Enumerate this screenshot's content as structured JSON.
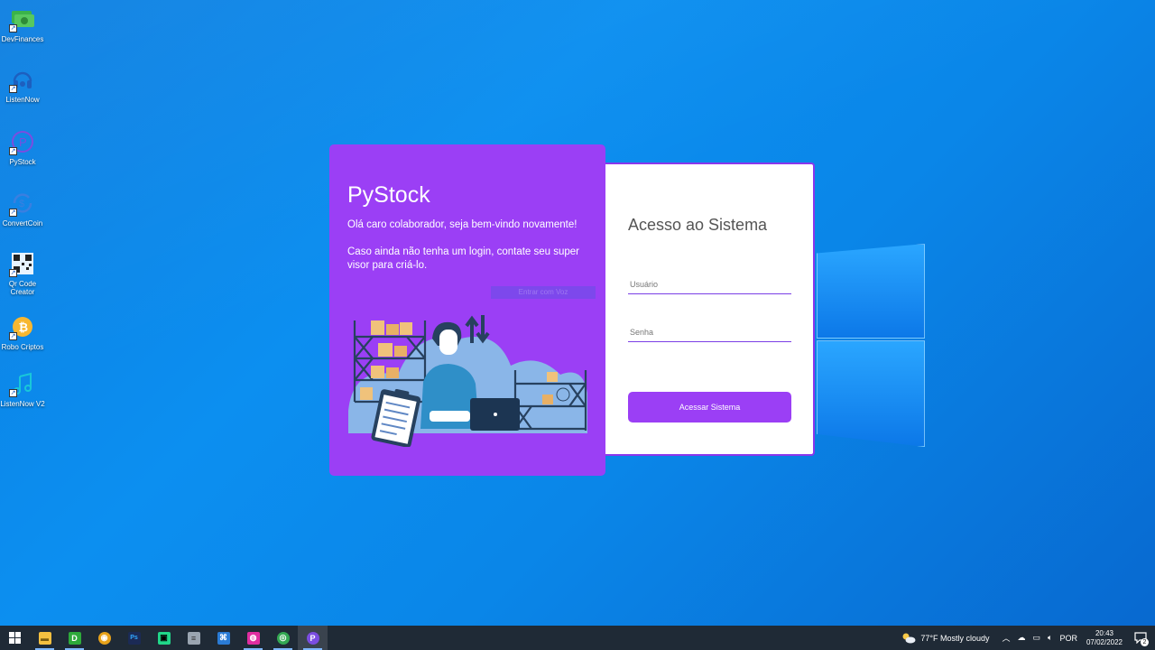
{
  "desktop": {
    "icons": [
      {
        "label": "DevFinances",
        "icon": "money-icon"
      },
      {
        "label": "ListenNow",
        "icon": "headphones-icon"
      },
      {
        "label": "PyStock",
        "icon": "pystock-icon"
      },
      {
        "label": "ConvertCoin",
        "icon": "convert-coin-icon"
      },
      {
        "label": "Qr Code Creator",
        "icon": "qr-code-icon"
      },
      {
        "label": "Robo Criptos",
        "icon": "bitcoin-icon"
      },
      {
        "label": "ListenNow V2",
        "icon": "music-note-icon"
      }
    ]
  },
  "login": {
    "brand": "PyStock",
    "welcome": "Olá caro colaborador, seja bem-vindo novamente!",
    "info": "Caso ainda não tenha um login, contate seu super visor para criá-lo.",
    "faint_button": "Entrar com Voz",
    "access_title": "Acesso ao Sistema",
    "username_placeholder": "Usuário",
    "password_placeholder": "Senha",
    "submit_label": "Acessar Sistema"
  },
  "colors": {
    "purple": "#9b3ff5",
    "purple_border": "#8a36ec",
    "desktop_blue": "#0c8ff0",
    "taskbar": "#1f2a36"
  },
  "taskbar": {
    "apps": [
      {
        "name": "file-explorer-icon",
        "color": "#f5c040",
        "glyph": "▬"
      },
      {
        "name": "dbeaver-icon",
        "color": "#2eaa3b",
        "glyph": "D"
      },
      {
        "name": "chrome-canary-icon",
        "color": "#e7a21a",
        "glyph": "◉"
      },
      {
        "name": "photoshop-icon",
        "color": "#1b2a55",
        "glyph": "Ps"
      },
      {
        "name": "pycharm-icon",
        "color": "#21d789",
        "glyph": "▣"
      },
      {
        "name": "database-icon",
        "color": "#9aa5b1",
        "glyph": "≡"
      },
      {
        "name": "vscode-icon",
        "color": "#2a7bd5",
        "glyph": "⌘"
      },
      {
        "name": "insomnia-icon",
        "color": "#e02da0",
        "glyph": "◍"
      },
      {
        "name": "chrome-icon",
        "color": "#34a853",
        "glyph": "◎"
      },
      {
        "name": "pystock-taskbar-icon",
        "color": "#7b4de0",
        "glyph": "P"
      }
    ],
    "weather": "77°F  Mostly cloudy",
    "language": "POR",
    "time": "20:43",
    "date": "07/02/2022",
    "notifications": "2"
  }
}
